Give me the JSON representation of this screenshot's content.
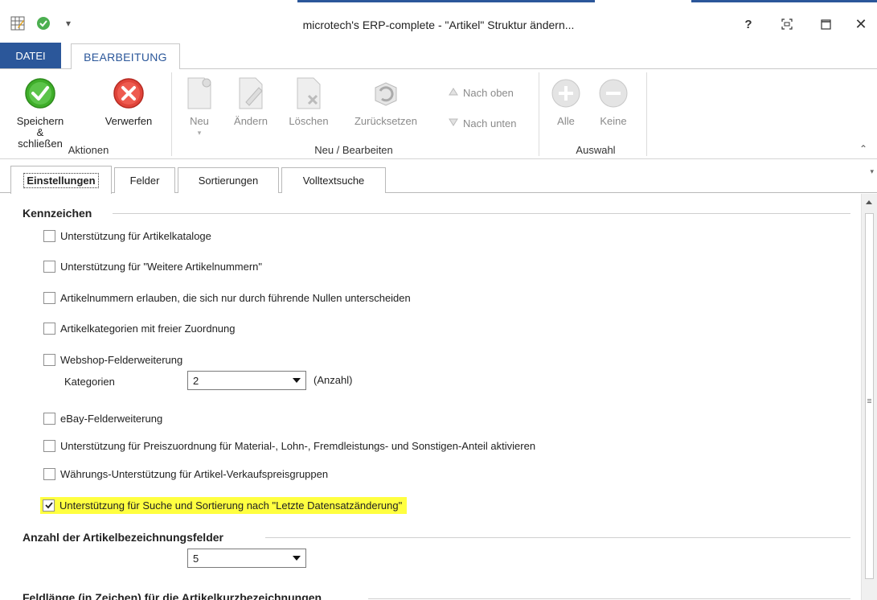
{
  "window": {
    "title": "microtech's ERP-complete - \"Artikel\" Struktur ändern...",
    "help_label": "?"
  },
  "ribbon_tabs": {
    "datei": "DATEI",
    "bearbeitung": "BEARBEITUNG"
  },
  "ribbon": {
    "aktionen": {
      "label": "Aktionen",
      "save_line1": "Speichern",
      "save_line2": "& schließen",
      "discard": "Verwerfen"
    },
    "neu_bearbeiten": {
      "label": "Neu / Bearbeiten",
      "neu": "Neu",
      "aendern": "Ändern",
      "loeschen": "Löschen",
      "zuruecksetzen": "Zurücksetzen",
      "nach_oben": "Nach oben",
      "nach_unten": "Nach unten"
    },
    "auswahl": {
      "label": "Auswahl",
      "alle": "Alle",
      "keine": "Keine"
    }
  },
  "page_tabs": [
    "Einstellungen",
    "Felder",
    "Sortierungen",
    "Volltextsuche"
  ],
  "kennzeichen": {
    "title": "Kennzeichen",
    "options": [
      {
        "label": "Unterstützung für Artikelkataloge",
        "checked": false
      },
      {
        "label": "Unterstützung für \"Weitere Artikelnummern\"",
        "checked": false
      },
      {
        "label": "Artikelnummern erlauben, die sich nur durch führende Nullen unterscheiden",
        "checked": false
      },
      {
        "label": "Artikelkategorien mit freier Zuordnung",
        "checked": false
      },
      {
        "label": "Webshop-Felderweiterung",
        "checked": false
      },
      {
        "label": "eBay-Felderweiterung",
        "checked": false
      },
      {
        "label": "Unterstützung für Preiszuordnung für Material-, Lohn-, Fremdleistungs- und Sonstigen-Anteil aktivieren",
        "checked": false
      },
      {
        "label": "Währungs-Unterstützung für Artikel-Verkaufspreisgruppen",
        "checked": false
      },
      {
        "label": "Unterstützung für Suche und Sortierung nach \"Letzte Datensatzänderung\"",
        "checked": true
      }
    ],
    "kategorien": {
      "label": "Kategorien",
      "value": "2",
      "suffix": "(Anzahl)"
    }
  },
  "anzahl_bezeichnungsfelder": {
    "title": "Anzahl der Artikelbezeichnungsfelder",
    "value": "5"
  },
  "feldlaenge": {
    "title": "Feldlänge (in Zeichen) für die Artikelkurzbezeichnungen"
  },
  "colors": {
    "accent": "#2b579a",
    "highlight": "#ffff40",
    "save_green": "#3fae2a",
    "discard_red": "#e0443a"
  }
}
